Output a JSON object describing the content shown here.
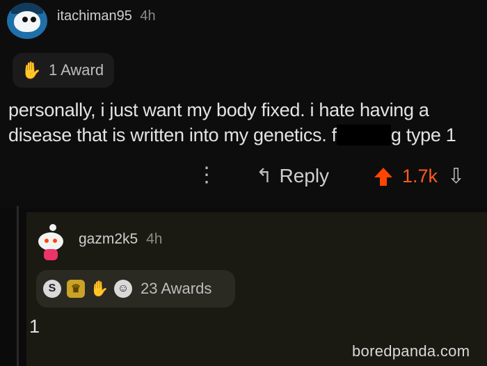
{
  "comment": {
    "username": "itachiman95",
    "time": "4h",
    "award_count_label": "1 Award",
    "text_before": "personally, i just want my body fixed. i hate having a disease that is written into my genetics. f",
    "text_after": "g type 1",
    "actions": {
      "more": "⋮",
      "reply_label": "Reply",
      "score": "1.7k"
    }
  },
  "reply": {
    "username": "gazm2k5",
    "time": "4h",
    "awards_label": "23 Awards",
    "text": "1"
  },
  "watermark": "boredpanda.com",
  "colors": {
    "upvote": "#ff4500",
    "background": "#0b0b0b",
    "reply_background": "#1b1a12"
  }
}
